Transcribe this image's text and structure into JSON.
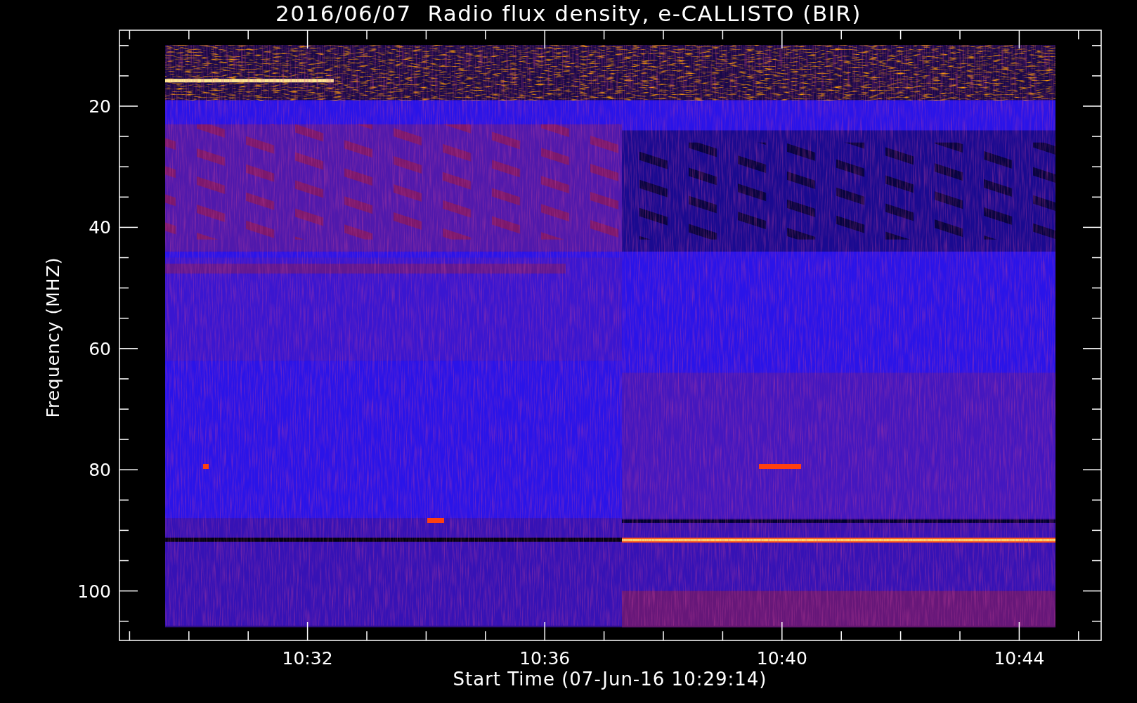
{
  "title": "2016/06/07  Radio flux density, e-CALLISTO (BIR)",
  "plot": {
    "ylabel": "Frequency (MHZ)",
    "xlabel": "Start Time (07-Jun-16 10:29:14)",
    "yticks": [
      "20",
      "40",
      "60",
      "80",
      "100"
    ],
    "xticks": [
      "10:32",
      "10:36",
      "10:40",
      "10:44"
    ]
  }
}
